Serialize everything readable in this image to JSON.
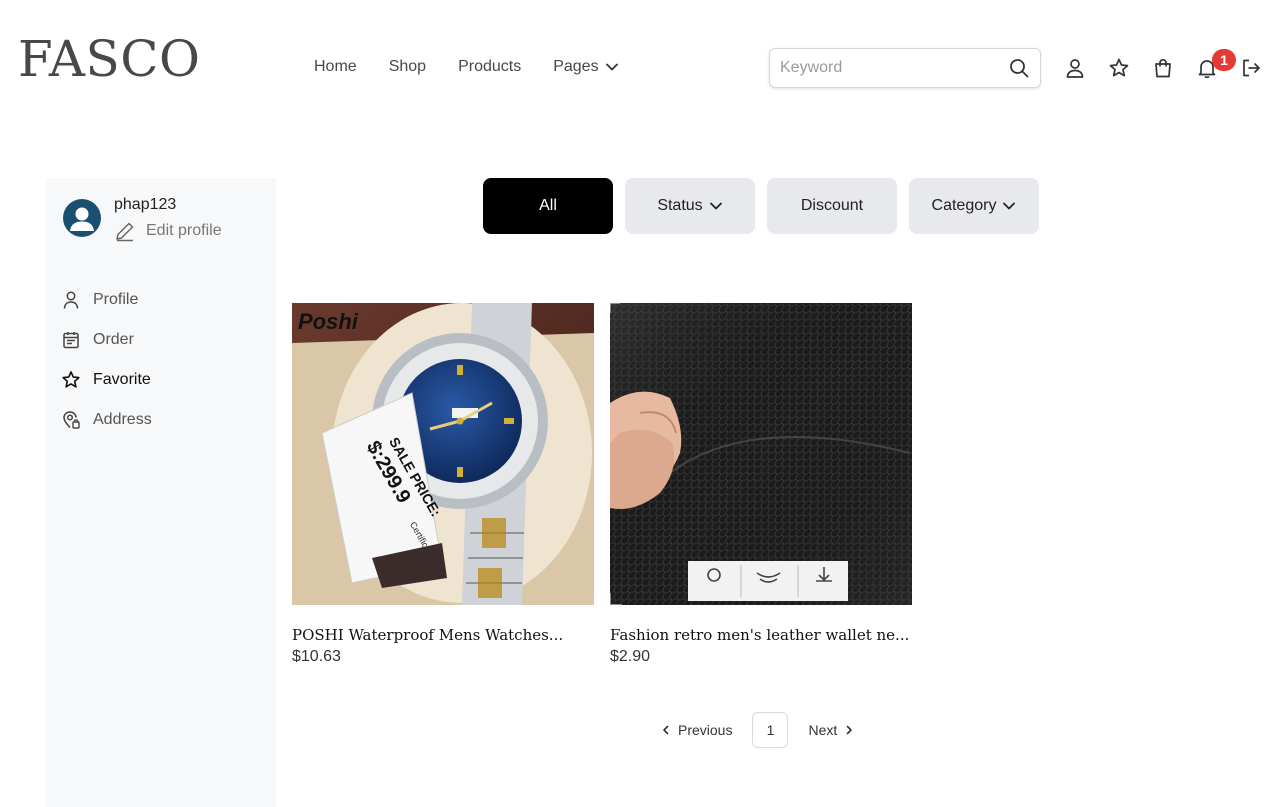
{
  "brand": {
    "logo": "FASCO"
  },
  "nav": {
    "items": [
      {
        "label": "Home"
      },
      {
        "label": "Shop"
      },
      {
        "label": "Products"
      },
      {
        "label": "Pages"
      }
    ]
  },
  "search": {
    "placeholder": "Keyword",
    "value": ""
  },
  "header_icons": [
    "user-icon",
    "star-icon",
    "shopping-bag-icon",
    "bell-icon",
    "logout-icon"
  ],
  "notifications": {
    "count": "1"
  },
  "sidebar": {
    "username": "phap123",
    "edit_label": "Edit profile",
    "items": [
      {
        "label": "Profile",
        "icon": "user-icon"
      },
      {
        "label": "Order",
        "icon": "calendar-icon"
      },
      {
        "label": "Favorite",
        "icon": "star-icon"
      },
      {
        "label": "Address",
        "icon": "map-pin-icon"
      }
    ]
  },
  "filters": [
    {
      "label": "All"
    },
    {
      "label": "Status"
    },
    {
      "label": "Discount"
    },
    {
      "label": "Category"
    }
  ],
  "products": [
    {
      "name": "POSHI Waterproof Mens Watches...",
      "price": "$10.63",
      "image_brand": "Poshi",
      "image_tag": "SALE PRICE:",
      "image_tag_price": "$:299.9",
      "image_tag_note": "Certificate"
    },
    {
      "name": "Fashion retro men's leather wallet ne...",
      "price": "$2.90"
    }
  ],
  "pagination": {
    "previous": "Previous",
    "current": "1",
    "next": "Next"
  },
  "colors": {
    "accent": "#000000",
    "badge": "#e53935",
    "filter_bg": "#e8e9ec",
    "sidebar_bg": "#f7f8fa"
  }
}
